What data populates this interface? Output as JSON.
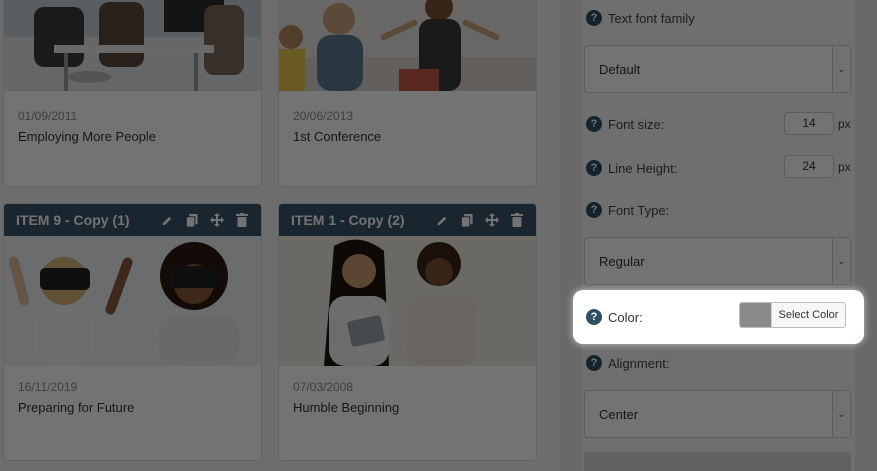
{
  "colors": {
    "header_bg": "#3a5568",
    "help_icon_bg": "#2f4f63",
    "current_color": "#8a8a8a"
  },
  "cards": [
    {
      "date": "01/09/2011",
      "text": "Employing More People"
    },
    {
      "date": "20/06/2013",
      "text": "1st Conference"
    },
    {
      "header": "ITEM 9 - Copy (1)",
      "date": "16/11/2019",
      "text": "Preparing for Future"
    },
    {
      "header": "ITEM 1 - Copy (2)",
      "date": "07/03/2008",
      "text": "Humble Beginning"
    }
  ],
  "settings": {
    "font_family_label": "Text font family",
    "font_family_value": "Default",
    "font_size_label": "Font size:",
    "font_size_value": "14",
    "line_height_label": "Line Height:",
    "line_height_value": "24",
    "unit": "px",
    "font_type_label": "Font Type:",
    "font_type_value": "Regular",
    "color_label": "Color:",
    "select_color_label": "Select Color",
    "alignment_label": "Alignment:",
    "alignment_value": "Center",
    "help_glyph": "?"
  }
}
